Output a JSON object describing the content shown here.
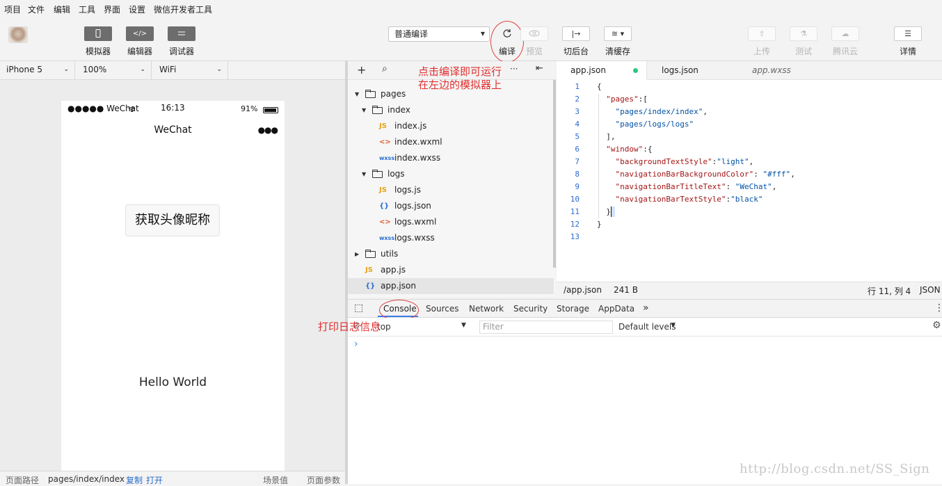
{
  "menubar": [
    "项目",
    "文件",
    "编辑",
    "工具",
    "界面",
    "设置",
    "微信开发者工具"
  ],
  "toolbar": {
    "simulator": "模拟器",
    "editor": "编辑器",
    "debugger": "调试器",
    "compile_mode": "普通编译",
    "compile": "编译",
    "preview": "预览",
    "background": "切后台",
    "clear_cache": "清缓存",
    "upload": "上传",
    "test": "测试",
    "tencent_cloud": "腾讯云",
    "details": "详情"
  },
  "simulator": {
    "device": "iPhone 5",
    "zoom": "100%",
    "network": "WiFi",
    "status_left": "●●●●● WeChat",
    "time": "16:13",
    "battery": "91%",
    "nav_title": "WeChat",
    "capsule": "●●●",
    "button": "获取头像昵称",
    "hello": "Hello World"
  },
  "sim_footer": {
    "path_label": "页面路径",
    "path": "pages/index/index",
    "copy": "复制",
    "open": "打开",
    "scene": "场景值",
    "params": "页面参数"
  },
  "tree_toolbar": {
    "add": "+",
    "search": "⌕",
    "more": "···",
    "collapse": "⇤"
  },
  "tree": [
    {
      "label": "pages",
      "type": "folder",
      "open": true,
      "depth": 0
    },
    {
      "label": "index",
      "type": "folder",
      "open": true,
      "depth": 1
    },
    {
      "label": "index.js",
      "type": "js",
      "depth": 2
    },
    {
      "label": "index.wxml",
      "type": "wxml",
      "depth": 2
    },
    {
      "label": "index.wxss",
      "type": "wxss",
      "depth": 2
    },
    {
      "label": "logs",
      "type": "folder",
      "open": true,
      "depth": 1
    },
    {
      "label": "logs.js",
      "type": "js",
      "depth": 2
    },
    {
      "label": "logs.json",
      "type": "json",
      "depth": 2
    },
    {
      "label": "logs.wxml",
      "type": "wxml",
      "depth": 2
    },
    {
      "label": "logs.wxss",
      "type": "wxss",
      "depth": 2
    },
    {
      "label": "utils",
      "type": "folder",
      "open": false,
      "depth": 0
    },
    {
      "label": "app.js",
      "type": "js",
      "depth": 0
    },
    {
      "label": "app.json",
      "type": "json",
      "depth": 0,
      "selected": true
    }
  ],
  "icons": {
    "js": "JS",
    "wxml": "<>",
    "wxss": "wxss",
    "json": "{}"
  },
  "tabs": [
    {
      "label": "app.json",
      "active": true,
      "modified": true
    },
    {
      "label": "logs.json"
    },
    {
      "label": "app.wxss",
      "italic": true
    }
  ],
  "code": [
    "{",
    "  \"pages\":[",
    "    \"pages/index/index\",",
    "    \"pages/logs/logs\"",
    "  ],",
    "  \"window\":{",
    "    \"backgroundTextStyle\":\"light\",",
    "    \"navigationBarBackgroundColor\": \"#fff\",",
    "    \"navigationBarTitleText\": \"WeChat\",",
    "    \"navigationBarTextStyle\":\"black\"",
    "  }",
    "}",
    ""
  ],
  "editor_status": {
    "file": "/app.json",
    "size": "241 B",
    "pos": "行 11, 列 4",
    "lang": "JSON"
  },
  "console_tabs": [
    "Console",
    "Sources",
    "Network",
    "Security",
    "Storage",
    "AppData"
  ],
  "console": {
    "context": "top",
    "filter_placeholder": "Filter",
    "levels": "Default levels",
    "prompt": "›"
  },
  "annotations": {
    "compile_line1": "点击编译即可运行",
    "compile_line2": "在左边的模拟器上",
    "console": "打印日志信息"
  },
  "watermark": "http://blog.csdn.net/SS_Sign",
  "colors": {
    "accent": "#3b7ee8",
    "annotation": "#e03030",
    "modified_dot": "#2ec77a"
  }
}
